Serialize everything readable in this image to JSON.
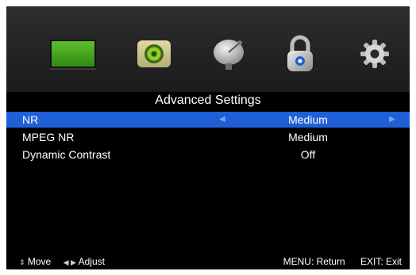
{
  "icon_bar": {
    "icons": [
      "tv-icon",
      "speaker-icon",
      "satellite-dish-icon",
      "padlock-icon",
      "gear-icon"
    ]
  },
  "menu": {
    "title": "Advanced Settings",
    "rows": [
      {
        "label": "NR",
        "value": "Medium",
        "selected": true
      },
      {
        "label": "MPEG NR",
        "value": "Medium",
        "selected": false
      },
      {
        "label": "Dynamic Contrast",
        "value": "Off",
        "selected": false
      }
    ]
  },
  "help_bar": {
    "move_icon": "up-down-arrows-icon",
    "move_label": "Move",
    "adjust_icon": "left-right-arrows-icon",
    "adjust_label": "Adjust",
    "menu_hint": "MENU: Return",
    "exit_hint": "EXIT: Exit"
  },
  "colors": {
    "background": "#000000",
    "selection": "#1f5fd8",
    "icon_bar": "#262626",
    "text": "#ffffff"
  }
}
